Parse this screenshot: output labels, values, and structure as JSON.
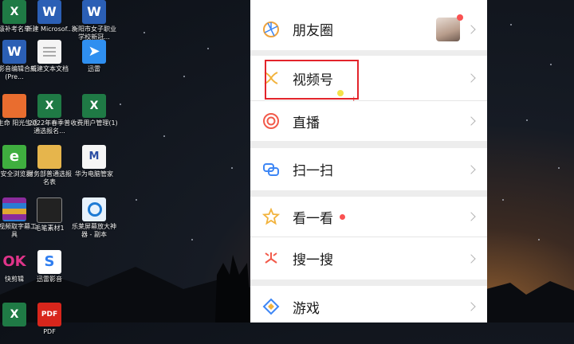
{
  "desktop": {
    "icons": [
      {
        "label": "级补考名单",
        "icon": "excel-file-icon"
      },
      {
        "label": "新建 Microsof...",
        "icon": "word-file-icon"
      },
      {
        "label": "衡阳市女子职业学校新冠...",
        "icon": "word-file-icon"
      },
      {
        "label": "现影音编辑合成(Pre...",
        "icon": "word-file-icon"
      },
      {
        "label": "新建文本文档",
        "icon": "text-document-icon"
      },
      {
        "label": "迅雷",
        "icon": "xunlei-icon"
      },
      {
        "label": "学生命 阳光生活",
        "icon": "ppt-file-icon"
      },
      {
        "label": "2022年春季普通选报名...",
        "icon": "excel-file-icon"
      },
      {
        "label": "收费用户管理(1)",
        "icon": "excel-file-icon"
      },
      {
        "label": "0安全浏览器",
        "icon": "browser-icon"
      },
      {
        "label": "财务部普通选报名表",
        "icon": "folder-icon"
      },
      {
        "label": "华为电脑管家",
        "icon": "huawei-pc-manager-icon"
      },
      {
        "label": "快视频取字幕工具",
        "icon": "winrar-icon"
      },
      {
        "label": "毛笔素材1",
        "icon": "screenshot-file-icon"
      },
      {
        "label": "乐莱屏幕放大神器 - 副本",
        "icon": "magnifier-icon"
      },
      {
        "label": "快剪辑",
        "icon": "ok-app-icon"
      },
      {
        "label": "迅雷影音",
        "icon": "xunlei-player-icon"
      },
      {
        "label": "",
        "icon": "excel-file-icon"
      },
      {
        "label": "PDF",
        "icon": "pdf-file-icon"
      }
    ]
  },
  "phone": {
    "menu": [
      {
        "label": "朋友圈",
        "icon": "moments-icon",
        "color": "#f0a33b",
        "has_avatar": true,
        "avatar_badge": true
      },
      {
        "label": "视频号",
        "icon": "channels-icon",
        "color": "#f2b33d",
        "highlighted": true
      },
      {
        "label": "直播",
        "icon": "live-icon",
        "color": "#f25a4a"
      },
      {
        "label": "扫一扫",
        "icon": "scan-icon",
        "color": "#3d86f5"
      },
      {
        "label": "看一看",
        "icon": "top-stories-icon",
        "color": "#f2b33d",
        "red_dot": true
      },
      {
        "label": "搜一搜",
        "icon": "search-icon",
        "color": "#f25a4a"
      },
      {
        "label": "游戏",
        "icon": "games-icon",
        "color": "#3d86f5"
      }
    ]
  },
  "colors": {
    "highlight_box": "#e3242b",
    "panel_bg": "#ededed",
    "red_dot": "#fa5151"
  }
}
